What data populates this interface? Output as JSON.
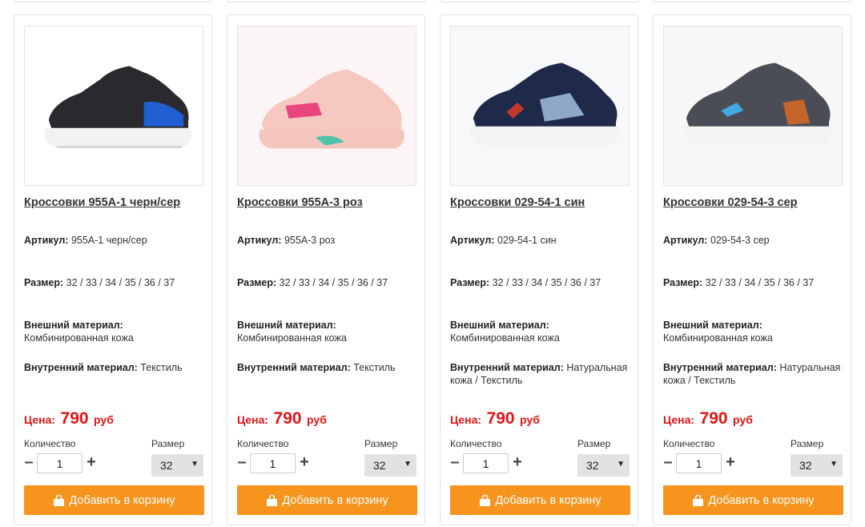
{
  "products": [
    {
      "title": "Кроссовки 955A-1 черн/сер",
      "sku_label": "Артикул:",
      "sku": "955A-1 черн/сер",
      "size_label": "Размер:",
      "sizes": "32 / 33 / 34 / 35 / 36 / 37",
      "outer_label": "Внешний материал:",
      "outer": "Комбинированная кожа",
      "inner_label": "Внутренний материал:",
      "inner": "Текстиль",
      "price_label": "Цена:",
      "price": "790",
      "currency": "руб",
      "qty_label": "Количество",
      "qty": "1",
      "size_select_label": "Размер",
      "selected_size": "32",
      "button_label": "Добавить в корзину",
      "colors": {
        "upper": "#2a2a2e",
        "accent": "#1f5fd1",
        "sole": "#f2f2f0",
        "bg": "#ffffff"
      }
    },
    {
      "title": "Кроссовки 955A-3 роз",
      "sku_label": "Артикул:",
      "sku": "955A-3 роз",
      "size_label": "Размер:",
      "sizes": "32 / 33 / 34 / 35 / 36 / 37",
      "outer_label": "Внешний материал:",
      "outer": "Комбинированная кожа",
      "inner_label": "Внутренний материал:",
      "inner": "Текстиль",
      "price_label": "Цена:",
      "price": "790",
      "currency": "руб",
      "qty_label": "Количество",
      "qty": "1",
      "size_select_label": "Размер",
      "selected_size": "32",
      "button_label": "Добавить в корзину",
      "colors": {
        "upper": "#f5c9c0",
        "accent": "#e8467f",
        "sole": "#f4c6bd",
        "bg": "#fbf6f5"
      }
    },
    {
      "title": "Кроссовки 029-54-1 син",
      "sku_label": "Артикул:",
      "sku": "029-54-1 син",
      "size_label": "Размер:",
      "sizes": "32 / 33 / 34 / 35 / 36 / 37",
      "outer_label": "Внешний материал:",
      "outer": "Комбинированная кожа",
      "inner_label": "Внутренний материал:",
      "inner": "Натуральная кожа / Текстиль",
      "price_label": "Цена:",
      "price": "790",
      "currency": "руб",
      "qty_label": "Количество",
      "qty": "1",
      "size_select_label": "Размер",
      "selected_size": "32",
      "button_label": "Добавить в корзину",
      "colors": {
        "upper": "#1f2a4a",
        "accent": "#8fa7c8",
        "sole": "#f4f4f4",
        "bg": "#f7f8fa"
      }
    },
    {
      "title": "Кроссовки 029-54-3 сер",
      "sku_label": "Артикул:",
      "sku": "029-54-3 сер",
      "size_label": "Размер:",
      "sizes": "32 / 33 / 34 / 35 / 36 / 37",
      "outer_label": "Внешний материал:",
      "outer": "Комбинированная кожа",
      "inner_label": "Внутренний материал:",
      "inner": "Натуральная кожа / Текстиль",
      "price_label": "Цена:",
      "price": "790",
      "currency": "руб",
      "qty_label": "Количество",
      "qty": "1",
      "size_select_label": "Размер",
      "selected_size": "32",
      "button_label": "Добавить в корзину",
      "colors": {
        "upper": "#4a4d55",
        "accent": "#c4662b",
        "sole": "#f4f4f4",
        "bg": "#f7f7f7"
      }
    }
  ],
  "icons": {
    "cart_button": "shopping-bag-icon",
    "minus": "minus-icon",
    "plus": "plus-icon",
    "dropdown": "caret-down-icon"
  },
  "theme": {
    "price_color": "#e21414",
    "button_color": "#f7941d",
    "button_text": "#ffffff",
    "select_bg": "#e2e2e2"
  }
}
